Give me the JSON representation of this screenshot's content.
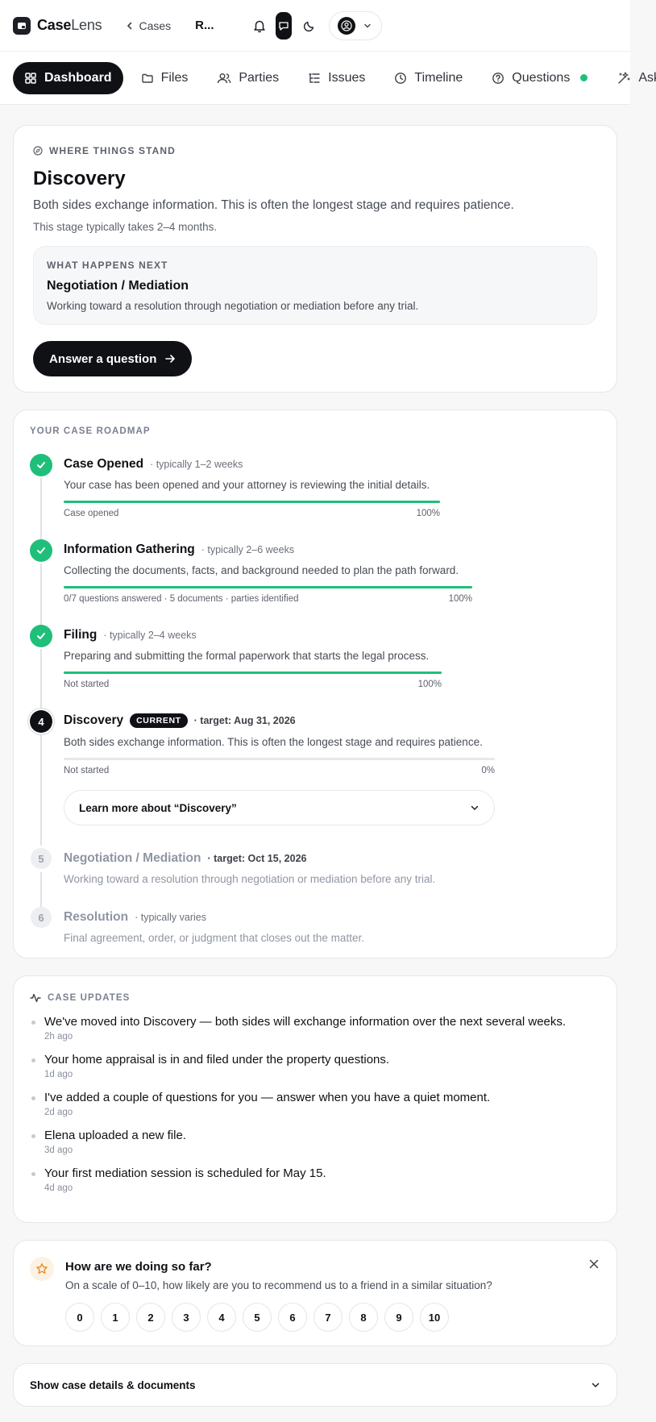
{
  "app": {
    "name_bold": "Case",
    "name_light": "Lens"
  },
  "header": {
    "back_label": "Cases",
    "current_case": "R..."
  },
  "tabs": [
    {
      "label": "Dashboard",
      "active": true
    },
    {
      "label": "Files"
    },
    {
      "label": "Parties"
    },
    {
      "label": "Issues"
    },
    {
      "label": "Timeline"
    },
    {
      "label": "Questions",
      "has_indicator": true
    },
    {
      "label": "Ask"
    }
  ],
  "stand": {
    "eyebrow": "Where things stand",
    "title": "Discovery",
    "description": "Both sides exchange information. This is often the longest stage and requires patience.",
    "duration": "This stage typically takes 2–4 months.",
    "next": {
      "eyebrow": "What happens next",
      "title": "Negotiation / Mediation",
      "description": "Working toward a resolution through negotiation or mediation before any trial."
    },
    "cta_label": "Answer a question"
  },
  "roadmap": {
    "eyebrow": "Your case roadmap",
    "stages": [
      {
        "status": "done",
        "name": "Case Opened",
        "meta": "· typically 1–2 weeks",
        "description": "Your case has been opened and your attorney is reviewing the initial details.",
        "progress_label": "Case opened",
        "progress": 100,
        "progress_pct": "100%"
      },
      {
        "status": "done",
        "name": "Information Gathering",
        "meta": "· typically 2–6 weeks",
        "description": "Collecting the documents, facts, and background needed to plan the path forward.",
        "progress_label": "0/7 questions answered · 5 documents · parties identified",
        "progress": 100,
        "progress_pct": "100%"
      },
      {
        "status": "done",
        "name": "Filing",
        "meta": "· typically 2–4 weeks",
        "description": "Preparing and submitting the formal paperwork that starts the legal process.",
        "progress_label": "Not started",
        "progress": 100,
        "progress_pct": "100%"
      },
      {
        "status": "current",
        "number": "4",
        "name": "Discovery",
        "badge": "CURRENT",
        "meta": "· target: Aug 31, 2026",
        "description": "Both sides exchange information. This is often the longest stage and requires patience.",
        "progress_label": "Not started",
        "progress": 0,
        "progress_pct": "0%",
        "learn_more": "Learn more about “Discovery”"
      },
      {
        "status": "future",
        "number": "5",
        "name": "Negotiation / Mediation",
        "meta": "· target: Oct 15, 2026",
        "description": "Working toward a resolution through negotiation or mediation before any trial."
      },
      {
        "status": "future",
        "number": "6",
        "name": "Resolution",
        "meta": "· typically varies",
        "description": "Final agreement, order, or judgment that closes out the matter."
      }
    ]
  },
  "updates": {
    "eyebrow": "Case updates",
    "items": [
      {
        "text": "We've moved into Discovery — both sides will exchange information over the next several weeks.",
        "time": "2h ago"
      },
      {
        "text": "Your home appraisal is in and filed under the property questions.",
        "time": "1d ago"
      },
      {
        "text": "I've added a couple of questions for you — answer when you have a quiet moment.",
        "time": "2d ago"
      },
      {
        "text": "Elena uploaded a new file.",
        "time": "3d ago"
      },
      {
        "text": "Your first mediation session is scheduled for May 15.",
        "time": "4d ago"
      }
    ]
  },
  "nps": {
    "title": "How are we doing so far?",
    "subtitle": "On a scale of 0–10, how likely are you to recommend us to a friend in a similar situation?",
    "scale": [
      "0",
      "1",
      "2",
      "3",
      "4",
      "5",
      "6",
      "7",
      "8",
      "9",
      "10"
    ]
  },
  "details": {
    "label": "Show case details & documents"
  },
  "colors": {
    "accent": "#0f1115",
    "success": "#1fbf7a",
    "indicator": "#1fbf7a"
  }
}
